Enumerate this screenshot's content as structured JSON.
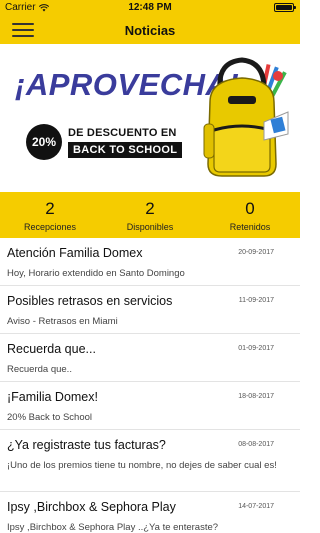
{
  "status_bar": {
    "carrier": "Carrier",
    "time": "12:48 PM"
  },
  "navbar": {
    "title": "Noticias"
  },
  "banner": {
    "headline": "¡APROVECHA!",
    "discount": "20%",
    "line1": "DE DESCUENTO EN",
    "line2": "BACK TO SCHOOL"
  },
  "stats": [
    {
      "value": "2",
      "label": "Recepciones"
    },
    {
      "value": "2",
      "label": "Disponibles"
    },
    {
      "value": "0",
      "label": "Retenidos"
    }
  ],
  "news": [
    {
      "title": "Atención Familia Domex",
      "date": "20-09-2017",
      "subtitle": "Hoy, Horario extendido en Santo Domingo"
    },
    {
      "title": "Posibles retrasos en servicios",
      "date": "11-09-2017",
      "subtitle": "Aviso - Retrasos en Miami"
    },
    {
      "title": "Recuerda que...",
      "date": "01-09-2017",
      "subtitle": "Recuerda que.."
    },
    {
      "title": "¡Familia Domex!",
      "date": "18-08-2017",
      "subtitle": "20% Back to School"
    },
    {
      "title": "¿Ya registraste tus facturas?",
      "date": "08-08-2017",
      "subtitle": "¡Uno de los premios tiene tu nombre, no dejes de saber cual es!"
    },
    {
      "title": "Ipsy ,Birchbox & Sephora Play",
      "date": "14-07-2017",
      "subtitle": "Ipsy ,Birchbox & Sephora Play ..¿Ya te enteraste?"
    }
  ]
}
